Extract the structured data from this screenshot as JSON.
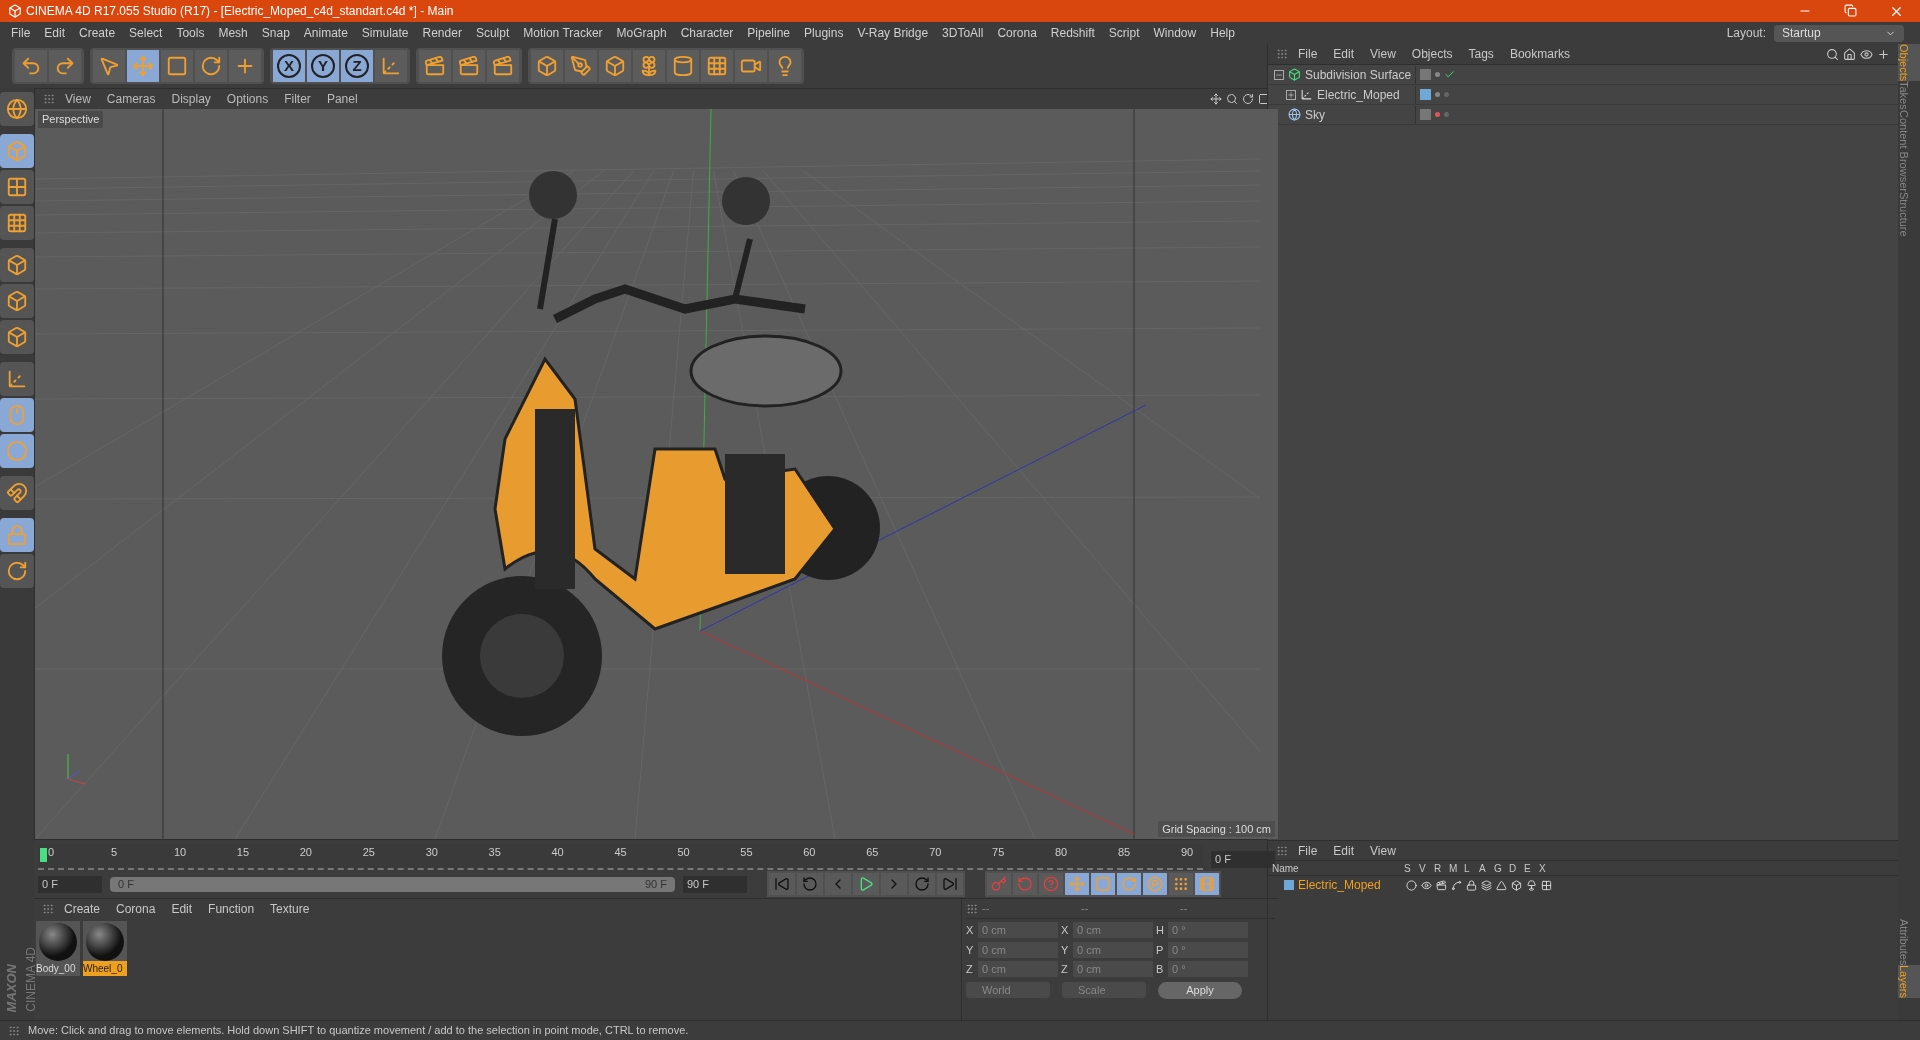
{
  "window": {
    "title": "CINEMA 4D R17.055 Studio (R17) - [Electric_Moped_c4d_standart.c4d *] - Main"
  },
  "menu": [
    "File",
    "Edit",
    "Create",
    "Select",
    "Tools",
    "Mesh",
    "Snap",
    "Animate",
    "Simulate",
    "Render",
    "Sculpt",
    "Motion Tracker",
    "MoGraph",
    "Character",
    "Pipeline",
    "Plugins",
    "V-Ray Bridge",
    "3DToAll",
    "Corona",
    "Redshift",
    "Script",
    "Window",
    "Help"
  ],
  "layout": {
    "label": "Layout:",
    "value": "Startup"
  },
  "toolbar": [
    {
      "kind": "tool",
      "selected": false
    },
    {
      "kind": "tool",
      "selected": false
    },
    {
      "kind": "tool",
      "selected": false
    },
    {
      "kind": "tool",
      "selected": true
    },
    {
      "kind": "tool",
      "selected": false
    },
    {
      "kind": "tool",
      "selected": false
    },
    {
      "kind": "tool",
      "selected": false
    },
    {
      "kind": "axis",
      "label": "X",
      "selected": true
    },
    {
      "kind": "axis",
      "label": "Y",
      "selected": true
    },
    {
      "kind": "axis",
      "label": "Z",
      "selected": true
    },
    {
      "kind": "tool",
      "selected": false
    },
    {
      "kind": "tool",
      "selected": false
    },
    {
      "kind": "tool",
      "selected": false
    },
    {
      "kind": "tool",
      "selected": false
    },
    {
      "kind": "tool",
      "selected": false
    },
    {
      "kind": "tool",
      "selected": false
    },
    {
      "kind": "tool",
      "selected": false
    },
    {
      "kind": "tool",
      "selected": false
    },
    {
      "kind": "tool",
      "selected": false
    },
    {
      "kind": "tool",
      "selected": false
    },
    {
      "kind": "tool",
      "selected": false
    },
    {
      "kind": "tool",
      "selected": false
    }
  ],
  "left_tools": [
    {
      "selected": false
    },
    {
      "selected": true
    },
    {
      "selected": false
    },
    {
      "selected": false
    },
    {
      "selected": false
    },
    {
      "selected": false
    },
    {
      "selected": false
    },
    {
      "selected": false
    },
    {
      "selected": true
    },
    {
      "selected": true
    },
    {
      "selected": false
    },
    {
      "selected": true
    },
    {
      "selected": false
    }
  ],
  "logo": {
    "brand": "MAXON",
    "product": "CINEMA 4D"
  },
  "viewport": {
    "menu": [
      "View",
      "Cameras",
      "Display",
      "Options",
      "Filter",
      "Panel"
    ],
    "camera": "Perspective",
    "grid_spacing": "Grid Spacing : 100 cm"
  },
  "objects": {
    "menu": [
      "File",
      "Edit",
      "View",
      "Objects",
      "Tags",
      "Bookmarks"
    ],
    "tree": [
      {
        "name": "Subdivision Surface",
        "kind": "generator",
        "expanded": true,
        "layer": false,
        "checked": true,
        "render_off": false,
        "children": [
          {
            "name": "Electric_Moped",
            "kind": "null",
            "expanded": false,
            "layer": true,
            "checked": false,
            "render_off": false
          }
        ]
      },
      {
        "name": "Sky",
        "kind": "sky",
        "layer": false,
        "checked": false,
        "render_off": true
      }
    ]
  },
  "side_tabs_top": [
    {
      "label": "Objects",
      "selected": true
    },
    {
      "label": "Takes",
      "selected": false
    },
    {
      "label": "Content Browser",
      "selected": false
    },
    {
      "label": "Structure",
      "selected": false
    }
  ],
  "side_tabs_bottom": [
    {
      "label": "Attributes",
      "selected": false
    },
    {
      "label": "Layers",
      "selected": true
    }
  ],
  "timeline": {
    "ticks": [
      "0",
      "5",
      "10",
      "15",
      "20",
      "25",
      "30",
      "35",
      "40",
      "45",
      "50",
      "55",
      "60",
      "65",
      "70",
      "75",
      "80",
      "85",
      "90"
    ],
    "end_field": "0 F",
    "start": "0 F",
    "range_start": "0 F",
    "range_end": "90 F",
    "range_slider": {
      "level": 1
    },
    "end": "90 F",
    "keys": [
      {
        "selected": false
      },
      {
        "selected": false
      },
      {
        "selected": false
      },
      {
        "selected": true
      },
      {
        "selected": true
      },
      {
        "selected": true
      },
      {
        "selected": true
      },
      {
        "selected": false
      },
      {
        "selected": true
      }
    ]
  },
  "materials": {
    "menu": [
      "Create",
      "Corona",
      "Edit",
      "Function",
      "Texture"
    ],
    "items": [
      {
        "name": "Body_00",
        "selected": false
      },
      {
        "name": "Wheel_0",
        "selected": true
      }
    ]
  },
  "coordinates": {
    "headers": [
      "--",
      "--",
      "--"
    ],
    "rows": [
      [
        "X",
        "0 cm",
        "X",
        "0 cm",
        "H",
        "0 °"
      ],
      [
        "Y",
        "0 cm",
        "Y",
        "0 cm",
        "P",
        "0 °"
      ],
      [
        "Z",
        "0 cm",
        "Z",
        "0 cm",
        "B",
        "0 °"
      ]
    ],
    "mode": "World",
    "transform": "Scale",
    "apply": "Apply"
  },
  "layers": {
    "menu": [
      "File",
      "Edit",
      "View"
    ],
    "columns": [
      "Name",
      "S",
      "V",
      "R",
      "M",
      "L",
      "A",
      "G",
      "D",
      "E",
      "X"
    ],
    "rows": [
      {
        "name": "Electric_Moped",
        "color": "#6fa8d6"
      }
    ]
  },
  "status_bar": "Move: Click and drag to move elements. Hold down SHIFT to quantize movement / add to the selection in point mode, CTRL to remove."
}
